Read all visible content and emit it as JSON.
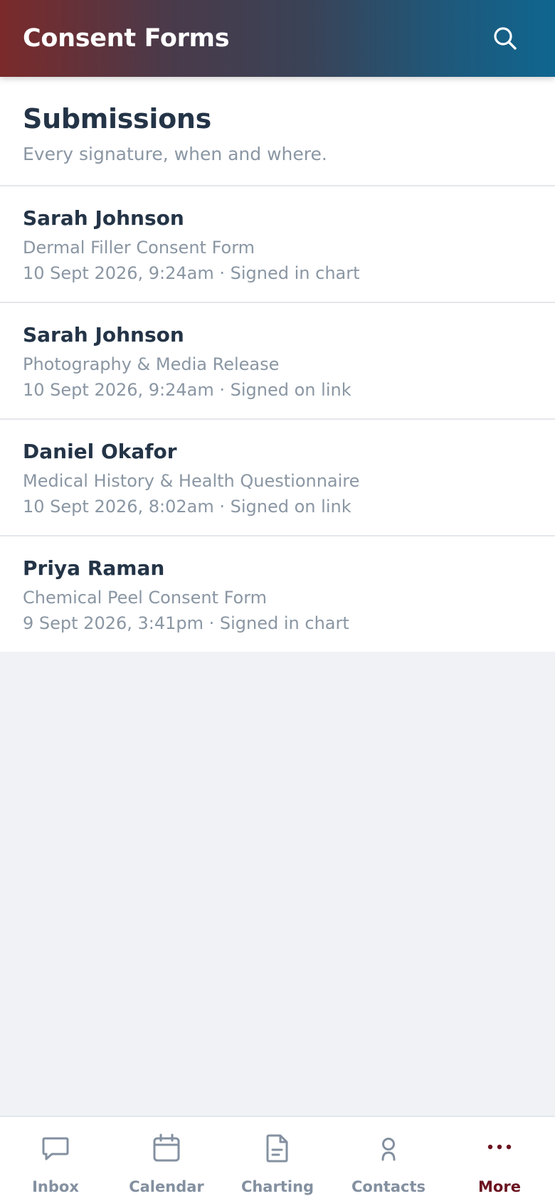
{
  "header": {
    "title": "Consent Forms",
    "search_icon": "search-icon"
  },
  "submissions": {
    "title": "Submissions",
    "tagline": "Every signature, when and where."
  },
  "items": [
    {
      "name": "Sarah Johnson",
      "form": "Dermal Filler Consent Form",
      "meta": "10 Sept 2026, 9:24am · Signed in chart"
    },
    {
      "name": "Sarah Johnson",
      "form": "Photography & Media Release",
      "meta": "10 Sept 2026, 9:24am · Signed on link"
    },
    {
      "name": "Daniel Okafor",
      "form": "Medical History & Health Questionnaire",
      "meta": "10 Sept 2026, 8:02am · Signed on link"
    },
    {
      "name": "Priya Raman",
      "form": "Chemical Peel Consent Form",
      "meta": "9 Sept 2026, 3:41pm · Signed in chart"
    }
  ],
  "tabbar": {
    "tabs": [
      {
        "label": "Inbox",
        "icon": "chat-bubble-icon"
      },
      {
        "label": "Calendar",
        "icon": "calendar-icon"
      },
      {
        "label": "Charting",
        "icon": "document-icon"
      },
      {
        "label": "Contacts",
        "icon": "person-icon"
      },
      {
        "label": "More",
        "icon": "more-dots-icon",
        "active": true
      }
    ]
  },
  "colors": {
    "header_gradient_start": "#7b2a2a",
    "header_gradient_end": "#0f6690",
    "title_text": "#243447",
    "secondary_text": "#8a96a3",
    "active_tab": "#6b1420",
    "inactive_tab": "#8390a0",
    "background": "#f0f2f5"
  }
}
